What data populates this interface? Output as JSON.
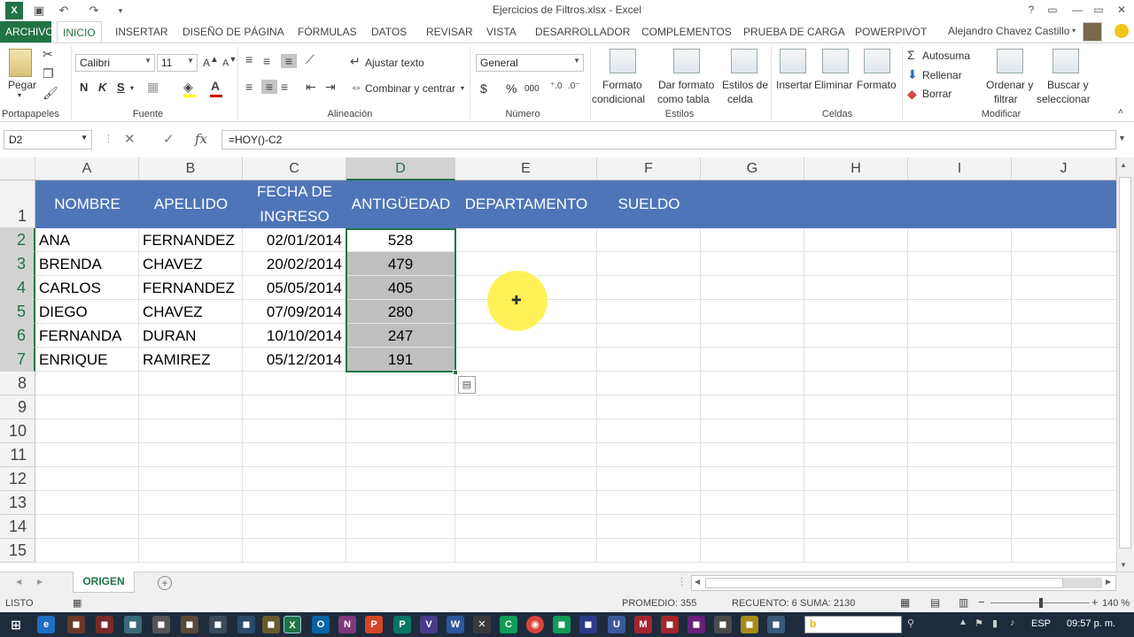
{
  "window": {
    "title": "Ejercicios de Filtros.xlsx - Excel",
    "user": "Alejandro Chavez Castillo"
  },
  "tabs": [
    "ARCHIVO",
    "INICIO",
    "INSERTAR",
    "DISEÑO DE PÁGINA",
    "FÓRMULAS",
    "DATOS",
    "REVISAR",
    "VISTA",
    "DESARROLLADOR",
    "COMPLEMENTOS",
    "PRUEBA DE CARGA",
    "POWERPIVOT"
  ],
  "ribbon": {
    "clipboard": {
      "paste": "Pegar",
      "group": "Portapapeles"
    },
    "font": {
      "name": "Calibri",
      "size": "11",
      "bold": "N",
      "italic": "K",
      "underline": "S",
      "group": "Fuente"
    },
    "alignment": {
      "wrap": "Ajustar texto",
      "merge": "Combinar y centrar",
      "group": "Alineación"
    },
    "number": {
      "format": "General",
      "currency": "$",
      "percent": "%",
      "thousands": "000",
      "group": "Número"
    },
    "styles": {
      "conditional1": "Formato",
      "conditional2": "condicional",
      "table1": "Dar formato",
      "table2": "como tabla",
      "cell1": "Estilos de",
      "cell2": "celda",
      "group": "Estilos"
    },
    "cells": {
      "insert": "Insertar",
      "delete": "Eliminar",
      "format": "Formato",
      "group": "Celdas"
    },
    "editing": {
      "autosum": "Autosuma",
      "fill": "Rellenar",
      "clear": "Borrar",
      "sort1": "Ordenar y",
      "sort2": "filtrar",
      "find1": "Buscar y",
      "find2": "seleccionar",
      "group": "Modificar"
    }
  },
  "formula_bar": {
    "name_box": "D2",
    "fx": "fx",
    "formula": "=HOY()-C2"
  },
  "columns": [
    "A",
    "B",
    "C",
    "D",
    "E",
    "F",
    "G",
    "H",
    "I",
    "J"
  ],
  "rows": [
    "1",
    "2",
    "3",
    "4",
    "5",
    "6",
    "7",
    "8",
    "9",
    "10",
    "11",
    "12",
    "13",
    "14",
    "15"
  ],
  "headers": {
    "nombre": "NOMBRE",
    "apellido": "APELLIDO",
    "fecha1": "FECHA DE",
    "fecha2": "INGRESO",
    "antiguedad": "ANTIGÜEDAD",
    "departamento": "DEPARTAMENTO",
    "sueldo": "SUELDO"
  },
  "data": [
    {
      "nombre": "ANA",
      "apellido": "FERNANDEZ",
      "fecha": "02/01/2014",
      "antiguedad": "528"
    },
    {
      "nombre": "BRENDA",
      "apellido": "CHAVEZ",
      "fecha": "20/02/2014",
      "antiguedad": "479"
    },
    {
      "nombre": "CARLOS",
      "apellido": "FERNANDEZ",
      "fecha": "05/05/2014",
      "antiguedad": "405"
    },
    {
      "nombre": "DIEGO",
      "apellido": "CHAVEZ",
      "fecha": "07/09/2014",
      "antiguedad": "280"
    },
    {
      "nombre": "FERNANDA",
      "apellido": "DURAN",
      "fecha": "10/10/2014",
      "antiguedad": "247"
    },
    {
      "nombre": "ENRIQUE",
      "apellido": "RAMIREZ",
      "fecha": "05/12/2014",
      "antiguedad": "191"
    }
  ],
  "sheet": {
    "tab": "ORIGEN"
  },
  "status": {
    "ready": "LISTO",
    "average": "PROMEDIO: 355",
    "count": "RECUENTO: 6",
    "sum": "SUMA: 2130",
    "zoom": "140 %"
  },
  "taskbar": {
    "lang": "ESP",
    "time": "09:57 p. m."
  }
}
